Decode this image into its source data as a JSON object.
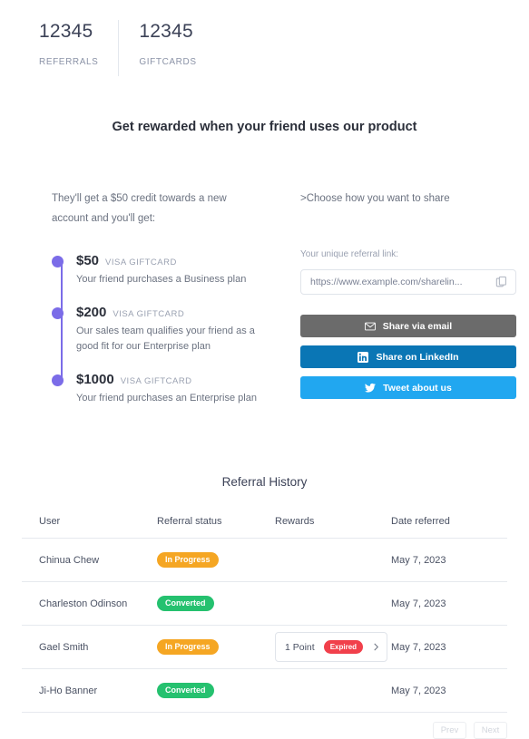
{
  "stats": [
    {
      "value": "12345",
      "label": "REFERRALS",
      "name": "referrals"
    },
    {
      "value": "12345",
      "label": "GIFTCARDS",
      "name": "giftcards"
    }
  ],
  "headline": "Get rewarded when your friend uses our product",
  "left": {
    "lead": "They'll get a $50 credit towards a new account and you'll get:",
    "tiers": [
      {
        "amount": "$50",
        "kind": "VISA GIFTCARD",
        "desc": "Your friend purchases a Business plan"
      },
      {
        "amount": "$200",
        "kind": "VISA GIFTCARD",
        "desc": "Our sales team qualifies your friend as a good fit for our Enterprise plan"
      },
      {
        "amount": "$1000",
        "kind": "VISA GIFTCARD",
        "desc": "Your friend purchases an Enterprise plan"
      }
    ]
  },
  "right": {
    "share_heading": ">Choose how you want to share",
    "link_label": "Your unique referral link:",
    "link_value": "https://www.example.com/sharelin...",
    "copy_icon": "copy-icon",
    "buttons": [
      {
        "label": "Share via email",
        "icon": "envelope-icon",
        "color": "#6b6b6b",
        "name": "share-via-email-button"
      },
      {
        "label": "Share on LinkedIn",
        "icon": "linkedin-icon",
        "color": "#0a76b5",
        "name": "share-on-linkedin-button"
      },
      {
        "label": "Tweet about us",
        "icon": "twitter-icon",
        "color": "#21a7f0",
        "name": "tweet-about-us-button"
      }
    ]
  },
  "history": {
    "title": "Referral History",
    "columns": [
      "User",
      "Referral status",
      "Rewards",
      "Date referred"
    ],
    "rows": [
      {
        "user": "Chinua Chew",
        "status": "In Progress",
        "status_type": "inprogress",
        "reward": null,
        "date": "May 7, 2023"
      },
      {
        "user": "Charleston Odinson",
        "status": "Converted",
        "status_type": "converted",
        "reward": null,
        "date": "May 7, 2023"
      },
      {
        "user": "Gael Smith",
        "status": "In Progress",
        "status_type": "inprogress",
        "reward": {
          "points": "1 Point",
          "badge": "Expired"
        },
        "date": "May 7, 2023"
      },
      {
        "user": "Ji-Ho Banner",
        "status": "Converted",
        "status_type": "converted",
        "reward": null,
        "date": "May 7, 2023"
      }
    ],
    "pagination": {
      "prev": "Prev",
      "next": "Next"
    }
  },
  "colors": {
    "accent_purple": "#7b6ce8",
    "status_inprogress": "#f5a623",
    "status_converted": "#25c16f",
    "status_expired": "#f1404b",
    "email_button": "#6b6b6b",
    "linkedin_button": "#0a76b5",
    "twitter_button": "#21a7f0"
  }
}
